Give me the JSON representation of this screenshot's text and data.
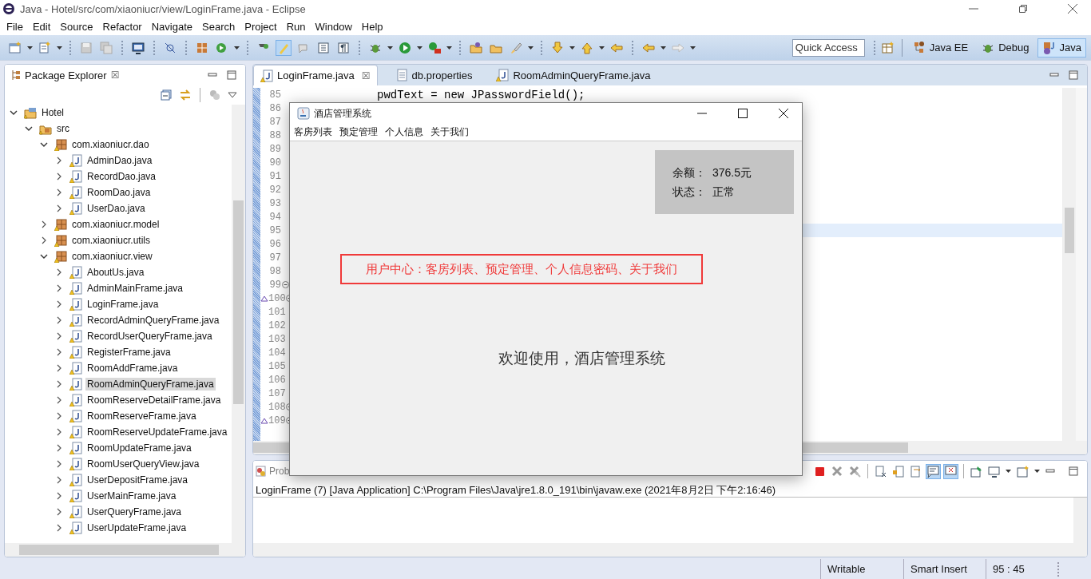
{
  "window": {
    "title": "Java - Hotel/src/com/xiaoniucr/view/LoginFrame.java - Eclipse"
  },
  "menu": [
    "File",
    "Edit",
    "Source",
    "Refactor",
    "Navigate",
    "Search",
    "Project",
    "Run",
    "Window",
    "Help"
  ],
  "quick_access": {
    "placeholder": "Quick Access"
  },
  "perspectives": [
    {
      "label": "Java EE",
      "selected": false
    },
    {
      "label": "Debug",
      "selected": false
    },
    {
      "label": "Java",
      "selected": true
    }
  ],
  "package_explorer": {
    "title": "Package Explorer",
    "close": "☒",
    "tree": [
      {
        "label": "Hotel",
        "kind": "project",
        "expanded": true,
        "selected": false,
        "children": [
          {
            "label": "src",
            "kind": "source",
            "expanded": true,
            "selected": false,
            "children": [
              {
                "label": "com.xiaoniucr.dao",
                "kind": "package",
                "expanded": true,
                "selected": false,
                "children": [
                  {
                    "label": "AdminDao.java",
                    "kind": "java",
                    "expanded": false,
                    "selected": false
                  },
                  {
                    "label": "RecordDao.java",
                    "kind": "java",
                    "expanded": false,
                    "selected": false
                  },
                  {
                    "label": "RoomDao.java",
                    "kind": "java",
                    "expanded": false,
                    "selected": false
                  },
                  {
                    "label": "UserDao.java",
                    "kind": "java",
                    "expanded": false,
                    "selected": false
                  }
                ]
              },
              {
                "label": "com.xiaoniucr.model",
                "kind": "package",
                "expanded": false,
                "selected": false
              },
              {
                "label": "com.xiaoniucr.utils",
                "kind": "package",
                "expanded": false,
                "selected": false
              },
              {
                "label": "com.xiaoniucr.view",
                "kind": "package",
                "expanded": true,
                "selected": false,
                "children": [
                  {
                    "label": "AboutUs.java",
                    "kind": "java",
                    "expanded": false,
                    "selected": false
                  },
                  {
                    "label": "AdminMainFrame.java",
                    "kind": "java",
                    "expanded": false,
                    "selected": false
                  },
                  {
                    "label": "LoginFrame.java",
                    "kind": "java",
                    "expanded": false,
                    "selected": false
                  },
                  {
                    "label": "RecordAdminQueryFrame.java",
                    "kind": "java",
                    "expanded": false,
                    "selected": false
                  },
                  {
                    "label": "RecordUserQueryFrame.java",
                    "kind": "java",
                    "expanded": false,
                    "selected": false
                  },
                  {
                    "label": "RegisterFrame.java",
                    "kind": "java",
                    "expanded": false,
                    "selected": false
                  },
                  {
                    "label": "RoomAddFrame.java",
                    "kind": "java",
                    "expanded": false,
                    "selected": false
                  },
                  {
                    "label": "RoomAdminQueryFrame.java",
                    "kind": "java",
                    "expanded": false,
                    "selected": true
                  },
                  {
                    "label": "RoomReserveDetailFrame.java",
                    "kind": "java",
                    "expanded": false,
                    "selected": false
                  },
                  {
                    "label": "RoomReserveFrame.java",
                    "kind": "java",
                    "expanded": false,
                    "selected": false
                  },
                  {
                    "label": "RoomReserveUpdateFrame.java",
                    "kind": "java",
                    "expanded": false,
                    "selected": false
                  },
                  {
                    "label": "RoomUpdateFrame.java",
                    "kind": "java",
                    "expanded": false,
                    "selected": false
                  },
                  {
                    "label": "RoomUserQueryView.java",
                    "kind": "java",
                    "expanded": false,
                    "selected": false
                  },
                  {
                    "label": "UserDepositFrame.java",
                    "kind": "java",
                    "expanded": false,
                    "selected": false
                  },
                  {
                    "label": "UserMainFrame.java",
                    "kind": "java",
                    "expanded": false,
                    "selected": false
                  },
                  {
                    "label": "UserQueryFrame.java",
                    "kind": "java",
                    "expanded": false,
                    "selected": false
                  },
                  {
                    "label": "UserUpdateFrame.java",
                    "kind": "java",
                    "expanded": false,
                    "selected": false
                  }
                ]
              }
            ]
          }
        ]
      }
    ]
  },
  "editor": {
    "tabs": [
      {
        "label": "LoginFrame.java",
        "kind": "java",
        "selected": true,
        "close": "☒"
      },
      {
        "label": "db.properties",
        "kind": "file",
        "selected": false
      },
      {
        "label": "RoomAdminQueryFrame.java",
        "kind": "java",
        "selected": false
      }
    ],
    "lines": [
      {
        "number": "85",
        "text": "pwdText = new JPasswordField();",
        "current": false
      },
      {
        "number": "86",
        "current": false
      },
      {
        "number": "87",
        "current": false
      },
      {
        "number": "88",
        "current": false
      },
      {
        "number": "89",
        "current": false
      },
      {
        "number": "90",
        "current": false
      },
      {
        "number": "91",
        "current": false
      },
      {
        "number": "92",
        "current": false
      },
      {
        "number": "93",
        "current": false
      },
      {
        "number": "94",
        "current": false
      },
      {
        "number": "95",
        "current": true
      },
      {
        "number": "96",
        "current": false
      },
      {
        "number": "97",
        "current": false
      },
      {
        "number": "98",
        "current": false
      },
      {
        "number": "99",
        "current": false,
        "foldable": true
      },
      {
        "number": "100",
        "current": false,
        "foldable": true,
        "override": true
      },
      {
        "number": "101",
        "current": false
      },
      {
        "number": "102",
        "current": false
      },
      {
        "number": "103",
        "current": false
      },
      {
        "number": "104",
        "current": false
      },
      {
        "number": "105",
        "current": false
      },
      {
        "number": "106",
        "current": false
      },
      {
        "number": "107",
        "current": false
      },
      {
        "number": "108",
        "current": false,
        "foldable": true
      },
      {
        "number": "109",
        "current": false,
        "foldable": true,
        "override": true
      }
    ]
  },
  "console": {
    "tab": "Prob",
    "header": "LoginFrame (7) [Java Application] C:\\Program Files\\Java\\jre1.8.0_191\\bin\\javaw.exe (2021年8月2日 下午2:16:46)"
  },
  "status_bar": [
    "Writable",
    "Smart Insert",
    "95 : 45"
  ],
  "dialog": {
    "title": "酒店管理系统",
    "menu": [
      "客房列表",
      "预定管理",
      "个人信息",
      "关于我们"
    ],
    "info": [
      {
        "label": "余额：",
        "value": "376.5元"
      },
      {
        "label": "状态：",
        "value": "正常"
      }
    ],
    "notice": "用户中心：客房列表、预定管理、个人信息密码、关于我们",
    "welcome": "欢迎使用，酒店管理系统"
  }
}
